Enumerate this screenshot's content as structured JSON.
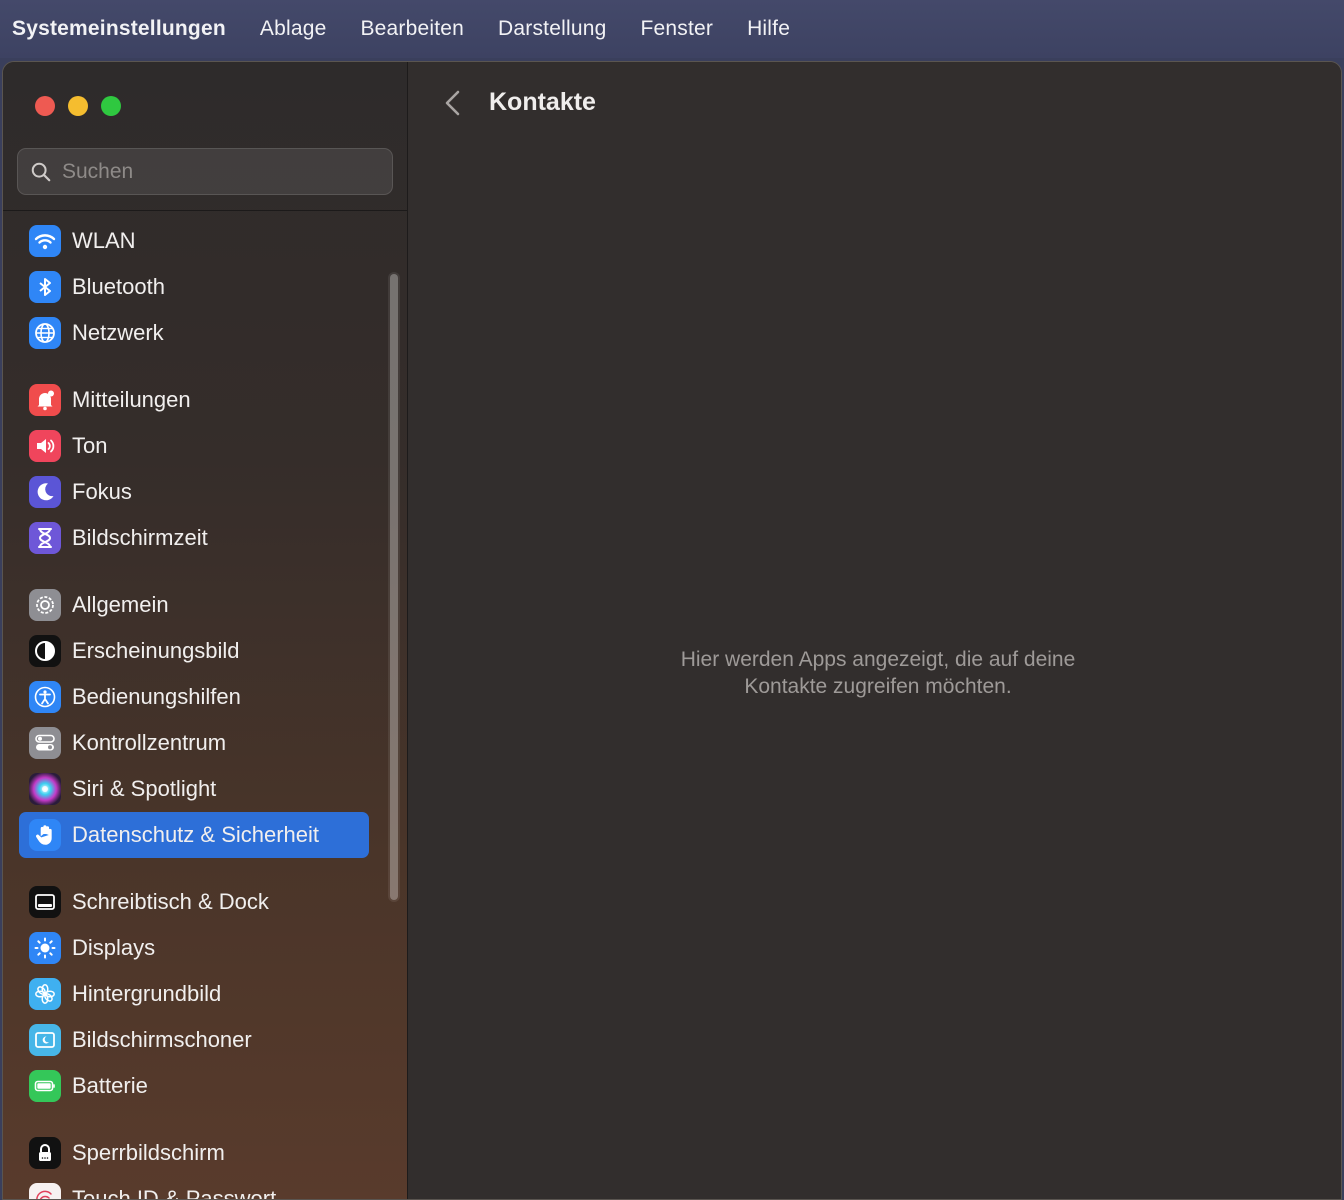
{
  "menubar": {
    "app": "Systemeinstellungen",
    "items": [
      "Ablage",
      "Bearbeiten",
      "Darstellung",
      "Fenster",
      "Hilfe"
    ]
  },
  "search": {
    "placeholder": "Suchen"
  },
  "sidebar": {
    "items": [
      {
        "label": "WLAN",
        "icon": "wifi-icon",
        "color": "#2f86f6"
      },
      {
        "label": "Bluetooth",
        "icon": "bluetooth-icon",
        "color": "#2f86f6"
      },
      {
        "label": "Netzwerk",
        "icon": "globe-icon",
        "color": "#2f86f6"
      },
      {
        "label": "Mitteilungen",
        "icon": "bell-icon",
        "color": "#f04c4c"
      },
      {
        "label": "Ton",
        "icon": "speaker-icon",
        "color": "#f0455c"
      },
      {
        "label": "Fokus",
        "icon": "moon-icon",
        "color": "#5b55d6"
      },
      {
        "label": "Bildschirmzeit",
        "icon": "hourglass-icon",
        "color": "#6e57d8"
      },
      {
        "label": "Allgemein",
        "icon": "gear-icon",
        "color": "#8e8e93"
      },
      {
        "label": "Erscheinungsbild",
        "icon": "appearance-icon",
        "color": "#111111"
      },
      {
        "label": "Bedienungshilfen",
        "icon": "accessibility-icon",
        "color": "#2f86f6"
      },
      {
        "label": "Kontrollzentrum",
        "icon": "toggles-icon",
        "color": "#8e8e93"
      },
      {
        "label": "Siri & Spotlight",
        "icon": "siri-icon",
        "color": "#2a1c3a"
      },
      {
        "label": "Datenschutz & Sicherheit",
        "icon": "hand-icon",
        "color": "#2f86f6"
      },
      {
        "label": "Schreibtisch & Dock",
        "icon": "dock-icon",
        "color": "#111111"
      },
      {
        "label": "Displays",
        "icon": "sun-icon",
        "color": "#2f86f6"
      },
      {
        "label": "Hintergrundbild",
        "icon": "flower-icon",
        "color": "#3fb0f0"
      },
      {
        "label": "Bildschirmschoner",
        "icon": "screensaver-icon",
        "color": "#47b6e8"
      },
      {
        "label": "Batterie",
        "icon": "battery-icon",
        "color": "#34c759"
      },
      {
        "label": "Sperrbildschirm",
        "icon": "lock-icon",
        "color": "#111111"
      },
      {
        "label": "Touch ID & Passwort",
        "icon": "fingerprint-icon",
        "color": "#f6f1f1"
      }
    ],
    "selected": "Datenschutz & Sicherheit"
  },
  "content": {
    "title": "Kontakte",
    "empty_line1": "Hier werden Apps angezeigt, die auf deine",
    "empty_line2": "Kontakte zugreifen möchten."
  }
}
